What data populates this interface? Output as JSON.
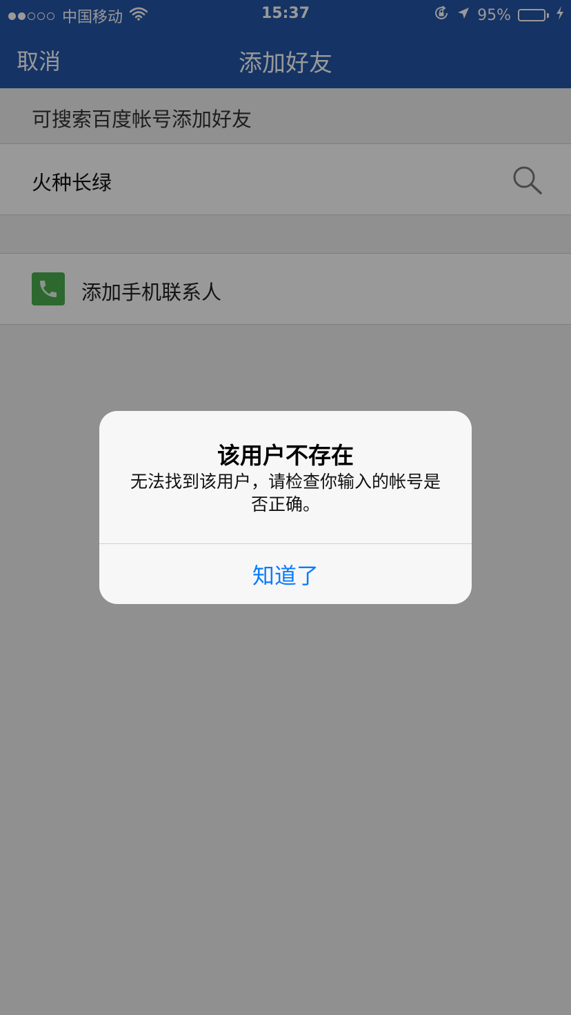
{
  "status_bar": {
    "carrier": "中国移动",
    "time": "15:37",
    "battery_percent": "95%",
    "battery_level": 0.95,
    "signal_bars": [
      true,
      true,
      false,
      false,
      false
    ],
    "icons": [
      "wifi-icon",
      "rotation-lock-icon",
      "location-arrow-icon",
      "battery-icon",
      "charging-bolt-icon"
    ]
  },
  "nav": {
    "cancel_label": "取消",
    "title": "添加好友"
  },
  "search_section": {
    "header": "可搜索百度帐号添加好友",
    "query_value": "火种长绿",
    "icon": "search-icon"
  },
  "contacts": {
    "label": "添加手机联系人",
    "icon": "phone-icon"
  },
  "alert": {
    "title": "该用户不存在",
    "message": "无法找到该用户，请检查你输入的帐号是否正确。",
    "button_label": "知道了"
  },
  "colors": {
    "nav_bar": "#2355a7",
    "phone_tile": "#4cae4f",
    "alert_button": "#0a7bff",
    "battery_fill": "#4cd964"
  }
}
